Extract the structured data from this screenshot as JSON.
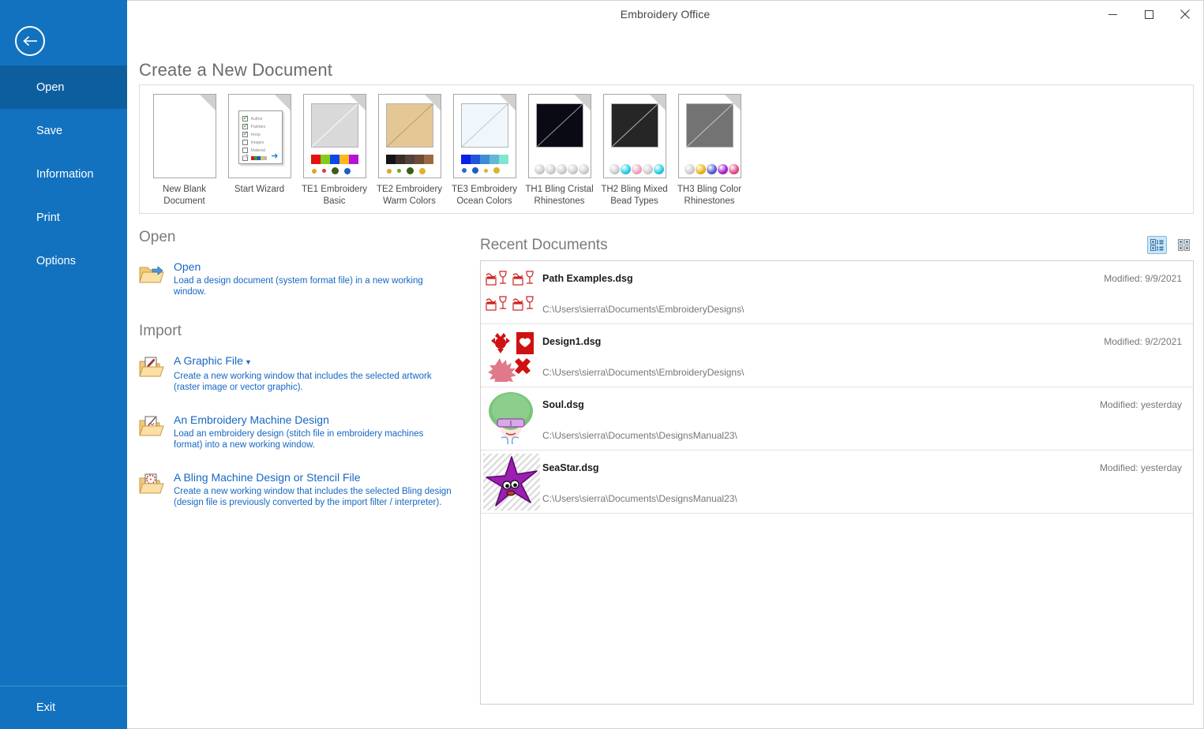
{
  "window": {
    "title": "Embroidery Office",
    "minimize_icon": "minimize-icon",
    "maximize_icon": "maximize-icon",
    "close_icon": "close-icon"
  },
  "sidebar": {
    "back_icon": "back-arrow-icon",
    "items": [
      {
        "label": "Open",
        "active": true
      },
      {
        "label": "Save",
        "active": false
      },
      {
        "label": "Information",
        "active": false
      },
      {
        "label": "Print",
        "active": false
      },
      {
        "label": "Options",
        "active": false
      }
    ],
    "exit": {
      "label": "Exit"
    }
  },
  "templates": {
    "heading": "Create a New Document",
    "items": [
      {
        "label": "New Blank Document",
        "kind": "blank"
      },
      {
        "label": "Start Wizard",
        "kind": "wizard",
        "rows": [
          {
            "text": "Author",
            "checked": true
          },
          {
            "text": "Palettes",
            "checked": true
          },
          {
            "text": "Hoop",
            "checked": true
          },
          {
            "text": "Images",
            "checked": false
          },
          {
            "text": "Material",
            "checked": false
          },
          {
            "text": "",
            "checked": false,
            "mini_colors": [
              "#d81818",
              "#2d9e2d",
              "#1a54c8",
              "#d8c463",
              "#b8b8b8"
            ]
          }
        ],
        "back_arrow": "←",
        "next_arrow": "→"
      },
      {
        "label": "TE1 Embroidery Basic",
        "kind": "fabric",
        "fabric_color": "#d9d9d9",
        "swatches": [
          "#e51111",
          "#82cc1b",
          "#0a48e8",
          "#ffb71b",
          "#b514d4"
        ],
        "dots": [
          {
            "color": "#e0a520",
            "size": 6
          },
          {
            "color": "#e03a3a",
            "size": 5
          },
          {
            "color": "#3a5f14",
            "size": 9
          },
          {
            "color": "#1a5fc8",
            "size": 8
          }
        ]
      },
      {
        "label": "TE2 Embroidery Warm Colors",
        "kind": "fabric",
        "fabric_color": "#e5c795",
        "swatches": [
          "#141414",
          "#3a2f28",
          "#52413c",
          "#6d4b38",
          "#9b6a42"
        ],
        "dots": [
          {
            "color": "#e0a520",
            "size": 6
          },
          {
            "color": "#6fa32a",
            "size": 5
          },
          {
            "color": "#3a5f14",
            "size": 9
          },
          {
            "color": "#e0b030",
            "size": 8
          }
        ]
      },
      {
        "label": "TE3 Embroidery Ocean Colors",
        "kind": "fabric",
        "fabric_color": "#eff7fc",
        "swatches": [
          "#0a1ee8",
          "#1f56d8",
          "#3f8cd8",
          "#64b6d8",
          "#7ee8cf"
        ],
        "dots": [
          {
            "color": "#2a6ad8",
            "size": 6
          },
          {
            "color": "#1a5fc8",
            "size": 8
          },
          {
            "color": "#e0b030",
            "size": 5
          },
          {
            "color": "#e0b030",
            "size": 8
          }
        ]
      },
      {
        "label": "TH1 Bling Cristal Rhinestones",
        "kind": "bling",
        "fabric_color": "#0a0a14",
        "stones": [
          "#d2d2d2",
          "#d2d2d2",
          "#d2d2d2",
          "#d2d2d2",
          "#d2d2d2"
        ]
      },
      {
        "label": "TH2 Bling Mixed Bead Types",
        "kind": "bling",
        "fabric_color": "#262626",
        "stones": [
          "#d2d2d2",
          "#2fd0ee",
          "#f2a8c0",
          "#d2d2d2",
          "#2fd0ee"
        ]
      },
      {
        "label": "TH3 Bling Color Rhinestones",
        "kind": "bling",
        "fabric_color": "#737373",
        "stones": [
          "#d2d2d2",
          "#f0b81a",
          "#5a63d8",
          "#a62ad4",
          "#e8528f"
        ]
      }
    ]
  },
  "open_section": {
    "heading": "Open",
    "entries": [
      {
        "icon": "open-folder-icon",
        "title": "Open",
        "has_caret": false,
        "description": "Load a design document (system format file) in a new working window."
      }
    ]
  },
  "import_section": {
    "heading": "Import",
    "entries": [
      {
        "icon": "graphic-file-folder-icon",
        "title": "A Graphic File",
        "has_caret": true,
        "caret": "▼",
        "description": "Create a new working window that includes the selected artwork (raster image or vector graphic)."
      },
      {
        "icon": "embroidery-design-folder-icon",
        "title": "An Embroidery Machine Design",
        "has_caret": false,
        "description": "Load an embroidery design (stitch file in embroidery machines format) into a new working window."
      },
      {
        "icon": "bling-design-folder-icon",
        "title": "A Bling Machine Design or Stencil File",
        "has_caret": false,
        "description": "Create a new working window that includes the selected Bling design (design file is previously converted by the import filter / interpreter)."
      }
    ]
  },
  "recent": {
    "heading": "Recent Documents",
    "view_buttons": [
      {
        "name": "details-view-button",
        "icon": "details-view-icon",
        "active": true
      },
      {
        "name": "tiles-view-button",
        "icon": "tiles-view-icon",
        "active": false
      }
    ],
    "documents": [
      {
        "name": "Path Examples.dsg",
        "path": "C:\\Users\\sierra\\Documents\\EmbroideryDesigns\\",
        "modified": "Modified: 9/9/2021",
        "thumb": "path-examples-thumb"
      },
      {
        "name": "Design1.dsg",
        "path": "C:\\Users\\sierra\\Documents\\EmbroideryDesigns\\",
        "modified": "Modified: 9/2/2021",
        "thumb": "design1-thumb"
      },
      {
        "name": "Soul.dsg",
        "path": "C:\\Users\\sierra\\Documents\\DesignsManual23\\",
        "modified": "Modified: yesterday",
        "thumb": "soul-thumb"
      },
      {
        "name": "SeaStar.dsg",
        "path": "C:\\Users\\sierra\\Documents\\DesignsManual23\\",
        "modified": "Modified: yesterday",
        "thumb": "seastar-thumb"
      }
    ]
  },
  "colors": {
    "rail": "#1272bf",
    "rail_active": "#0d5e9f",
    "link": "#1567c4",
    "heading": "#6b6b6b"
  }
}
